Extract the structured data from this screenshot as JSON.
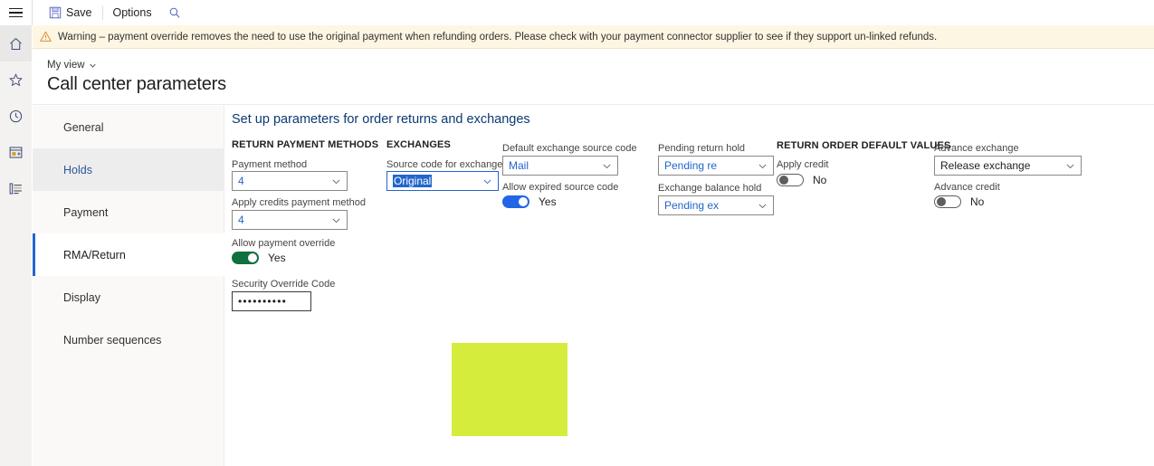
{
  "topbar": {
    "menu_icon": "hamburger-icon",
    "save_label": "Save",
    "save_icon": "save-floppy-icon",
    "options_label": "Options",
    "search_icon": "search-magnifier-icon"
  },
  "rail": {
    "items": [
      {
        "icon": "home-icon",
        "name": "home"
      },
      {
        "icon": "star-icon",
        "name": "favorites"
      },
      {
        "icon": "clock-icon",
        "name": "recent"
      },
      {
        "icon": "workspace-icon",
        "name": "workspaces"
      },
      {
        "icon": "list-icon",
        "name": "modules"
      }
    ]
  },
  "warning": {
    "icon": "warning-triangle-icon",
    "text": "Warning – payment override removes the need to use the original payment when refunding orders. Please check with your payment connector supplier to see if they support un-linked refunds."
  },
  "header": {
    "view_label": "My view",
    "view_chevron": "chevron-down-icon",
    "title": "Call center parameters"
  },
  "sidebar": {
    "items": [
      {
        "label": "General",
        "state": "normal"
      },
      {
        "label": "Holds",
        "state": "hover"
      },
      {
        "label": "Payment",
        "state": "normal"
      },
      {
        "label": "RMA/Return",
        "state": "selected"
      },
      {
        "label": "Display",
        "state": "normal"
      },
      {
        "label": "Number sequences",
        "state": "normal"
      }
    ]
  },
  "main": {
    "section_title": "Set up parameters for order returns and exchanges",
    "groups": {
      "return_payment_methods": "RETURN PAYMENT METHODS",
      "exchanges": "EXCHANGES",
      "return_order_default_values": "RETURN ORDER DEFAULT VALUES"
    },
    "fields": {
      "payment_method": {
        "label": "Payment method",
        "value": "4"
      },
      "apply_credits_payment_method": {
        "label": "Apply credits payment method",
        "value": "4"
      },
      "allow_payment_override": {
        "label": "Allow payment override",
        "value": "Yes",
        "on": true
      },
      "security_override_code": {
        "label": "Security Override Code",
        "value": "••••••••••"
      },
      "source_code_for_exchange": {
        "label": "Source code for exchange",
        "value": "Original"
      },
      "default_exchange_source_code": {
        "label": "Default exchange source code",
        "value": "Mail"
      },
      "allow_expired_source_code": {
        "label": "Allow expired source code",
        "value": "Yes",
        "on": true
      },
      "pending_return_hold": {
        "label": "Pending return hold",
        "value": "Pending re"
      },
      "exchange_balance_hold": {
        "label": "Exchange balance hold",
        "value": "Pending ex"
      },
      "apply_credit": {
        "label": "Apply credit",
        "value": "No",
        "on": false
      },
      "advance_exchange": {
        "label": "Advance exchange",
        "value": "Release exchange"
      },
      "advance_credit": {
        "label": "Advance credit",
        "value": "No",
        "on": false
      }
    }
  },
  "colors": {
    "accent": "#2266cc",
    "highlight": "#d6ec3c",
    "toggle_on": "#2266e6",
    "toggle_on_green": "#10703f",
    "warning_bg": "#fdf6e3"
  }
}
